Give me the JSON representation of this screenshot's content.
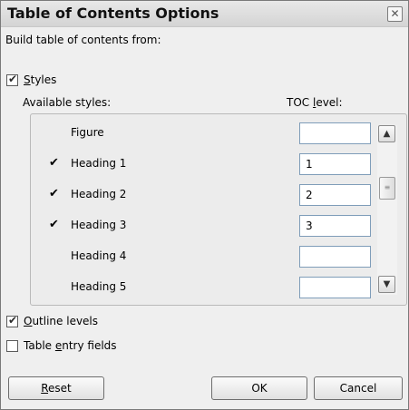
{
  "dialog": {
    "title": "Table of Contents Options",
    "close_glyph": "✕"
  },
  "build_from_label": "Build table of contents from:",
  "styles_checkbox": {
    "label_underlined": "S",
    "label_rest": "tyles",
    "checked": true
  },
  "columns": {
    "available_styles": "Available styles:",
    "toc_level_pre": "TOC ",
    "toc_level_ul": "l",
    "toc_level_post": "evel:"
  },
  "styles": [
    {
      "name": "Figure",
      "checked": false,
      "level": ""
    },
    {
      "name": "Heading 1",
      "checked": true,
      "level": "1"
    },
    {
      "name": "Heading 2",
      "checked": true,
      "level": "2"
    },
    {
      "name": "Heading 3",
      "checked": true,
      "level": "3"
    },
    {
      "name": "Heading 4",
      "checked": false,
      "level": ""
    },
    {
      "name": "Heading 5",
      "checked": false,
      "level": ""
    }
  ],
  "check_glyph": "✔",
  "outline_levels": {
    "label_underlined": "O",
    "label_rest": "utline levels",
    "checked": true
  },
  "table_entry_fields": {
    "label_pre": "Table ",
    "label_underlined": "e",
    "label_rest": "ntry fields",
    "checked": false
  },
  "buttons": {
    "reset_ul": "R",
    "reset_rest": "eset",
    "ok": "OK",
    "cancel": "Cancel"
  },
  "scroll": {
    "up_glyph": "▲",
    "down_glyph": "▼",
    "thumb_glyph": "≡"
  }
}
